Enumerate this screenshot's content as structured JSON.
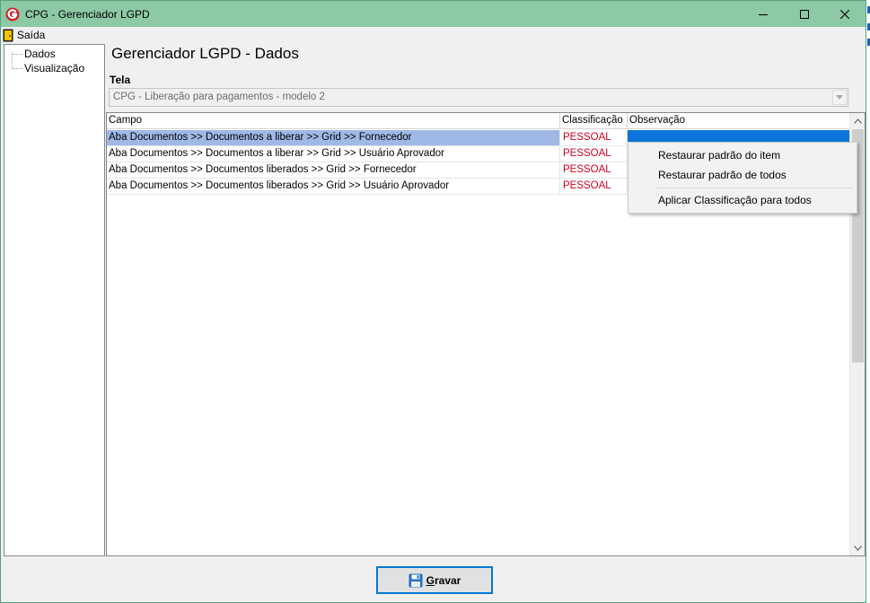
{
  "window": {
    "title": "CPG - Gerenciador LGPD",
    "accent": "#8cc9a4"
  },
  "menu": {
    "exit_label": "Saída"
  },
  "tree": {
    "items": [
      {
        "label": "Dados"
      },
      {
        "label": "Visualização"
      }
    ]
  },
  "main": {
    "heading": "Gerenciador LGPD - Dados",
    "tela_label": "Tela",
    "tela_value": "CPG - Liberação para pagamentos - modelo 2"
  },
  "grid": {
    "columns": [
      "Campo",
      "Classificação",
      "Observação"
    ],
    "rows": [
      {
        "campo": "Aba Documentos >> Documentos a liberar >> Grid >> Fornecedor",
        "classificacao": "PESSOAL",
        "observacao": "",
        "selected": true
      },
      {
        "campo": "Aba Documentos >> Documentos a liberar >> Grid >> Usuário Aprovador",
        "classificacao": "PESSOAL",
        "observacao": ""
      },
      {
        "campo": "Aba Documentos >> Documentos liberados >> Grid >> Fornecedor",
        "classificacao": "PESSOAL",
        "observacao": ""
      },
      {
        "campo": "Aba Documentos >> Documentos liberados >> Grid >> Usuário Aprovador",
        "classificacao": "PESSOAL",
        "observacao": ""
      }
    ],
    "classification_color": "#d0021b",
    "selection_color": "#0a74d8"
  },
  "context_menu": {
    "items": [
      {
        "label": "Restaurar padrão do item"
      },
      {
        "label": "Restaurar padrão de todos"
      },
      {
        "label": "Aplicar Classificação para todos"
      }
    ]
  },
  "footer": {
    "save_prefix": "G",
    "save_rest": "ravar",
    "save_icon": "floppy-disk-icon"
  }
}
